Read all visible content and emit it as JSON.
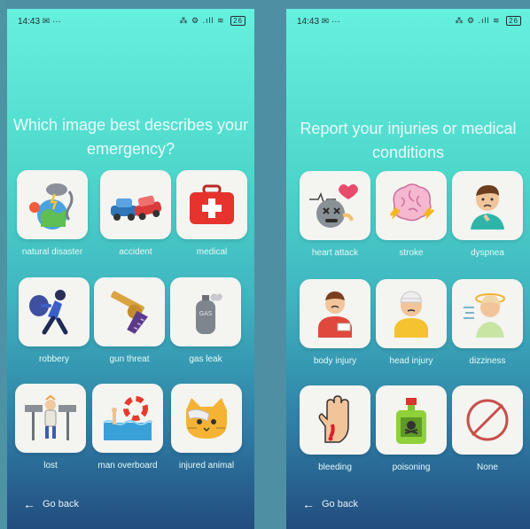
{
  "left_screen": {
    "status": {
      "time": "14:43 ✉ ···",
      "icons": "⁂ ⚙ .ıll ≋",
      "battery": "26"
    },
    "title": "Which image best describes your emergency?",
    "options": [
      {
        "label": "natural disaster",
        "icon": "natural-disaster-icon"
      },
      {
        "label": "accident",
        "icon": "car-accident-icon"
      },
      {
        "label": "medical",
        "icon": "first-aid-kit-icon"
      },
      {
        "label": "robbery",
        "icon": "robber-icon"
      },
      {
        "label": "gun threat",
        "icon": "revolver-icon"
      },
      {
        "label": "gas leak",
        "icon": "gas-cylinder-icon"
      },
      {
        "label": "lost",
        "icon": "lost-person-signpost-icon"
      },
      {
        "label": "man overboard",
        "icon": "lifebuoy-water-icon"
      },
      {
        "label": "injured animal",
        "icon": "injured-cat-icon"
      }
    ],
    "go_back": "Go back"
  },
  "right_screen": {
    "status": {
      "time": "14:43 ✉ ···",
      "icons": "⁂ ⚙ .ıll ≋",
      "battery": "26"
    },
    "title": "Report your injuries or medical conditions",
    "options": [
      {
        "label": "heart attack",
        "icon": "heart-attack-icon"
      },
      {
        "label": "stroke",
        "icon": "brain-stroke-icon"
      },
      {
        "label": "dyspnea",
        "icon": "breathing-difficulty-icon"
      },
      {
        "label": "body injury",
        "icon": "injured-person-icon"
      },
      {
        "label": "head injury",
        "icon": "bandaged-head-icon"
      },
      {
        "label": "dizziness",
        "icon": "dizzy-person-icon"
      },
      {
        "label": "bleeding",
        "icon": "bleeding-hand-icon"
      },
      {
        "label": "poisoning",
        "icon": "poison-bottle-icon"
      },
      {
        "label": "None",
        "icon": "none-circle-slash-icon"
      }
    ],
    "go_back": "Go back"
  },
  "colors": {
    "gradient_top": "#66f0de",
    "gradient_bottom": "#224c7e",
    "tile_bg": "#f4f4f1",
    "text": "#e6fbf8"
  }
}
